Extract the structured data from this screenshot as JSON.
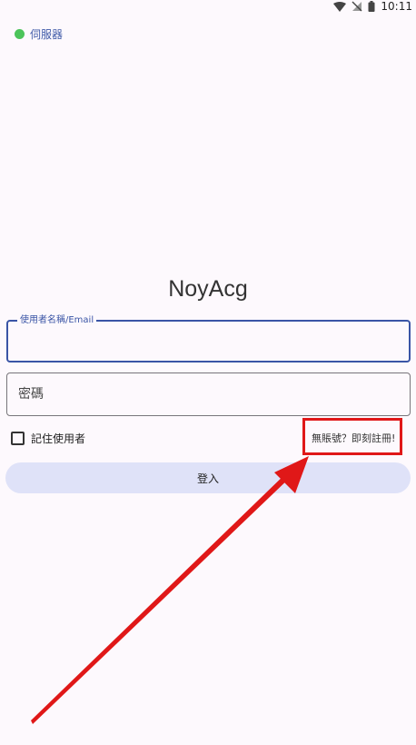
{
  "status_bar": {
    "time": "10:11",
    "icons": [
      "wifi-icon",
      "no-signal-icon",
      "battery-icon"
    ]
  },
  "server": {
    "label": "伺服器",
    "status_color": "#4cc45a"
  },
  "app_title": "NoyAcg",
  "login_form": {
    "username_label": "使用者名稱/Email",
    "username_value": "",
    "password_placeholder": "密碼",
    "password_value": "",
    "remember_label": "記住使用者",
    "remember_checked": false,
    "register_link": "無賬號？即刻註冊!",
    "login_button": "登入"
  },
  "annotation": {
    "highlight_color": "#e01818",
    "arrow_color": "#e01818"
  }
}
